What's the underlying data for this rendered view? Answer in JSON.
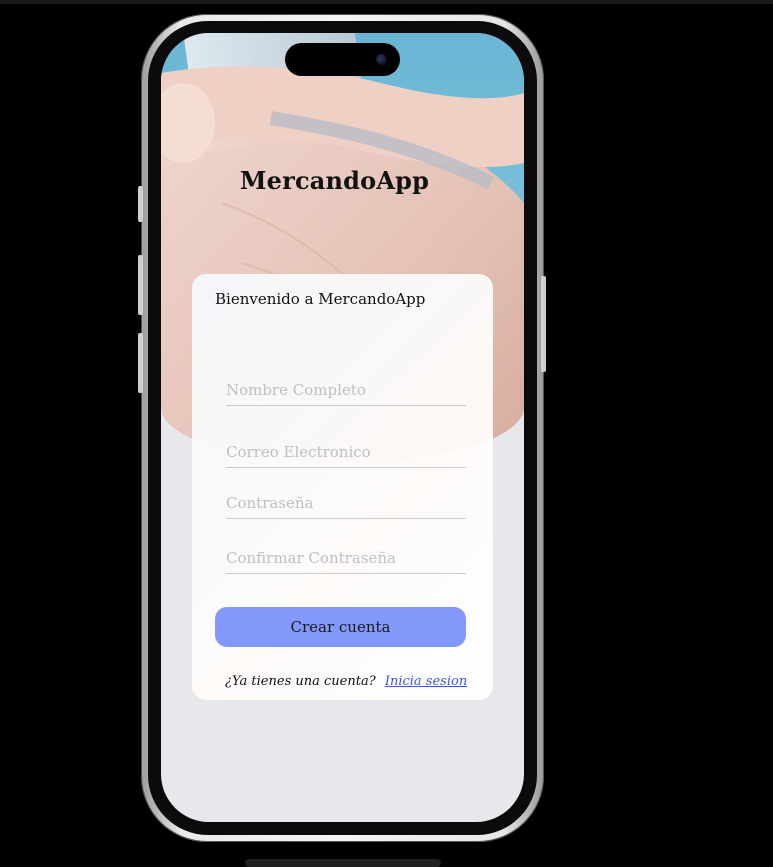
{
  "app": {
    "title": "MercandoApp"
  },
  "card": {
    "welcome": "Bienvenido a MercandoApp",
    "fields": {
      "full_name_placeholder": "Nombre Completo",
      "email_placeholder": "Correo Electronico",
      "password_placeholder": "Contraseña",
      "confirm_password_placeholder": "Confirmar Contraseña"
    },
    "create_account_label": "Crear cuenta",
    "have_account_text": "¿Ya tienes una cuenta?",
    "login_link": "Inicia sesion"
  },
  "colors": {
    "background": "#000000",
    "button": "#8398fb",
    "link": "#3a54f0",
    "hero_sky": "#69b6d4",
    "screen_bg": "#e6e8eb"
  },
  "icons": {
    "camera": "front-camera-icon"
  }
}
